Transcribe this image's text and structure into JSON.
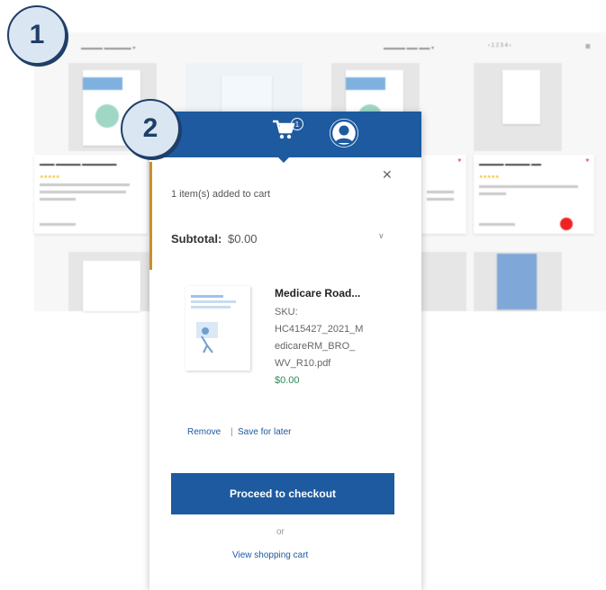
{
  "badges": {
    "step1": "1",
    "step2": "2"
  },
  "cart": {
    "count": "1",
    "added_message": "1 item(s) added to cart",
    "subtotal_label": "Subtotal:",
    "subtotal_value": "$0.00",
    "item": {
      "name": "Medicare Road...",
      "sku": "SKU:\nHC415427_2021_M\nedicareRM_BRO_\nWV_R10.pdf",
      "price": "$0.00"
    },
    "remove_label": "Remove",
    "separator": "|",
    "save_label": "Save for later",
    "checkout_label": "Proceed to checkout",
    "or_label": "or",
    "view_cart_label": "View shopping cart"
  },
  "icons": {
    "cart": "shopping-cart-icon",
    "user": "user-account-icon",
    "close": "close-icon",
    "chevron": "chevron-down-icon"
  },
  "colors": {
    "header": "#1d5aa0",
    "badge_border": "#1f3f68",
    "badge_fill": "#dbe6f3",
    "price": "#2e8a5e"
  }
}
